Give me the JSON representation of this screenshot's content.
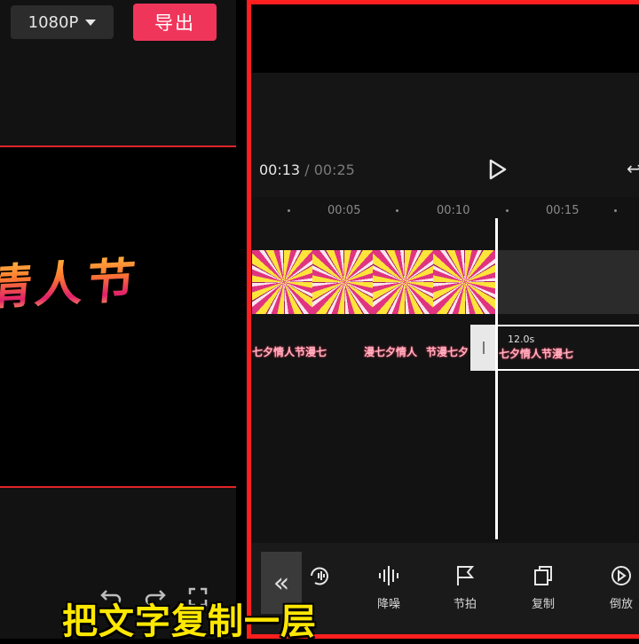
{
  "export_panel": {
    "resolution": "1080P",
    "export_label": "导出",
    "preview_text": "情人节"
  },
  "editor": {
    "time_current": "00:13",
    "time_separator": "/",
    "time_total": "00:25",
    "ruler_ticks": [
      "00:05",
      "00:10",
      "00:15"
    ],
    "text_pieces": [
      "七夕情人节漫七",
      "漫七夕情人",
      "节漫七夕",
      "节漫七夕情人节漫七"
    ],
    "selected_clip": {
      "duration": "12.0s",
      "text": "七夕情人节漫七"
    }
  },
  "toolbar": {
    "collapse_icon": "«",
    "tools": [
      {
        "label": "降噪",
        "icon": "noise-reduce-icon"
      },
      {
        "label": "节拍",
        "icon": "beat-flag-icon"
      },
      {
        "label": "复制",
        "icon": "copy-icon"
      },
      {
        "label": "倒放",
        "icon": "reverse-icon"
      }
    ]
  },
  "caption": "把文字复制一层",
  "colors": {
    "accent_red": "#f0355b",
    "frame_red": "#ff1f1f",
    "caption_yellow": "#ffe800"
  }
}
